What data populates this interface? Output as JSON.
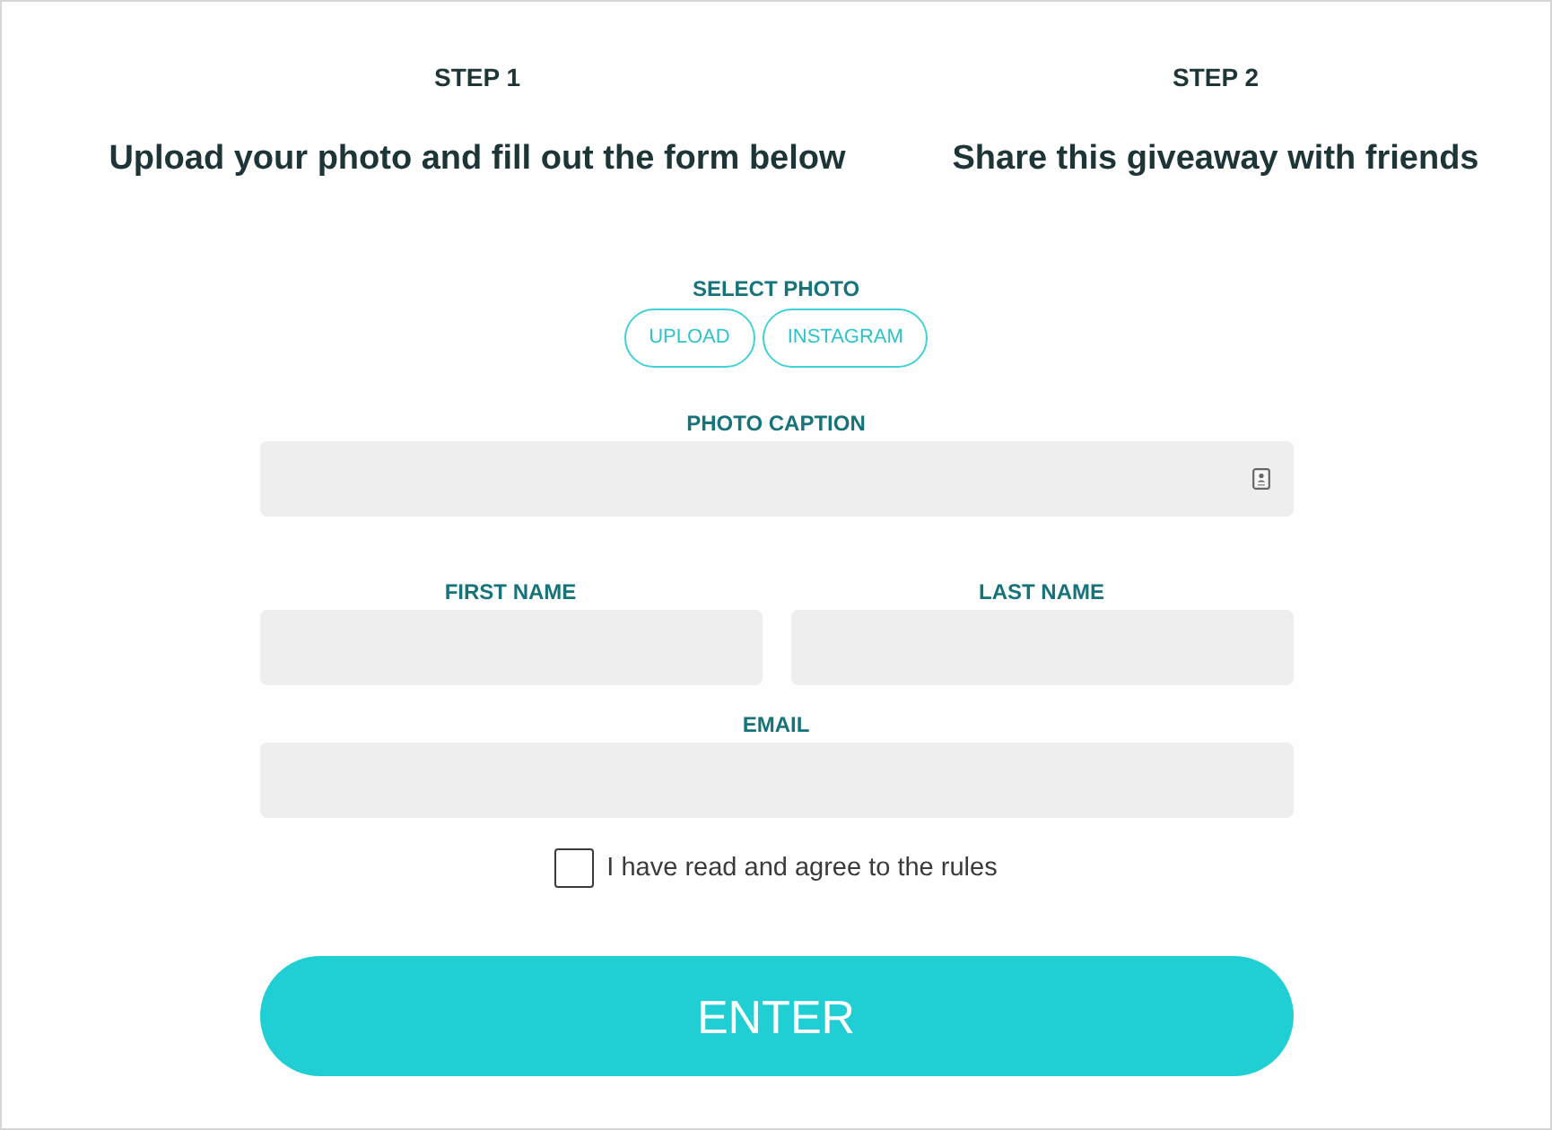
{
  "steps": [
    {
      "label": "STEP 1",
      "title": "Upload your photo and fill out the form below"
    },
    {
      "label": "STEP 2",
      "title": "Share this giveaway with friends"
    }
  ],
  "select_photo": {
    "label": "SELECT PHOTO",
    "buttons": [
      "UPLOAD",
      "INSTAGRAM"
    ]
  },
  "field_rows": [
    [
      {
        "label": "PHOTO CAPTION",
        "autofill_icon": true
      }
    ],
    [
      {
        "label": "FIRST NAME",
        "autofill_icon": false
      },
      {
        "label": "LAST NAME",
        "autofill_icon": false
      }
    ],
    [
      {
        "label": "EMAIL",
        "autofill_icon": false
      }
    ]
  ],
  "agree": {
    "label": "I have read and agree to the rules",
    "checked": false
  },
  "submit": {
    "label": "ENTER"
  }
}
